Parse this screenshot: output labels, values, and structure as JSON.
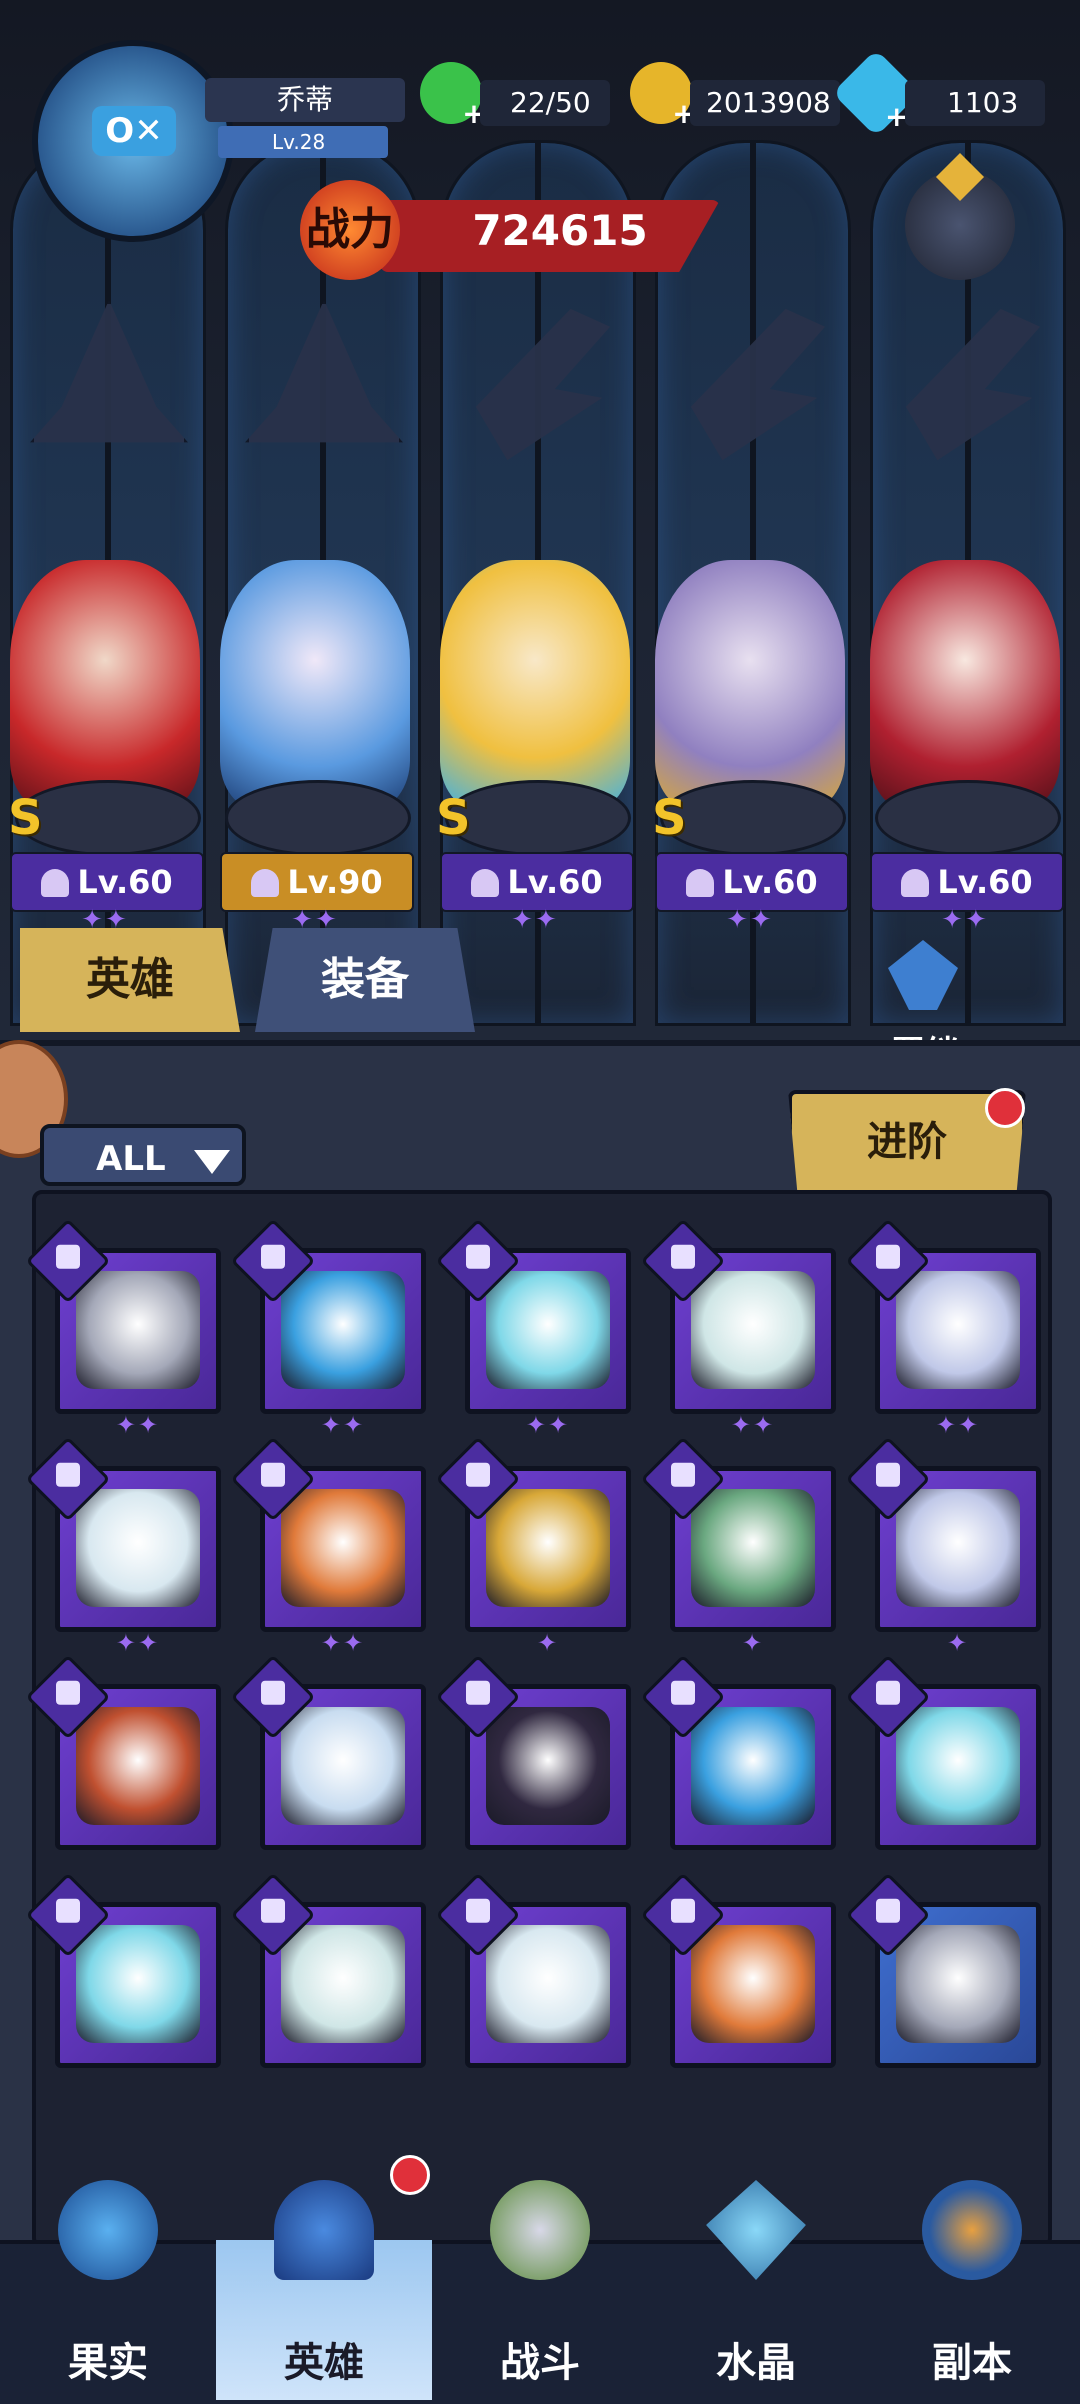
{
  "player": {
    "name": "乔蒂",
    "level": "Lv.28"
  },
  "resources": {
    "stamina": "22/50",
    "gold": "2013908",
    "diamonds": "1103"
  },
  "power": {
    "label": "战力",
    "value": "724615"
  },
  "heroes": [
    {
      "level": "Lv.60",
      "s_rank": "S",
      "stars": "✦✦",
      "class_icon": "mage-hat-icon"
    },
    {
      "level": "Lv.90",
      "s_rank": "",
      "stars": "✦✦",
      "class_icon": "mage-hat-icon"
    },
    {
      "level": "Lv.60",
      "s_rank": "S",
      "stars": "✦✦",
      "class_icon": "wing-icon"
    },
    {
      "level": "Lv.60",
      "s_rank": "S",
      "stars": "✦✦",
      "class_icon": "wing-icon"
    },
    {
      "level": "Lv.60",
      "s_rank": "",
      "stars": "✦✦",
      "class_icon": "wing-icon"
    }
  ],
  "tabs": {
    "heroes": "英雄",
    "equipment": "装备"
  },
  "bond": {
    "label": "羁绊"
  },
  "filter": {
    "label": "ALL"
  },
  "advance": {
    "label": "进阶"
  },
  "cards": [
    {
      "name": "knight-helmet",
      "stars": "✦✦",
      "color": "#a4a8b8"
    },
    {
      "name": "fishbowl-robot",
      "stars": "✦✦",
      "color": "#3aa0e0"
    },
    {
      "name": "armored-mech",
      "stars": "✦✦",
      "color": "#7fd8e8"
    },
    {
      "name": "ghost-crystal",
      "stars": "✦✦",
      "color": "#cfe6e6"
    },
    {
      "name": "dragon-beast",
      "stars": "✦✦",
      "color": "#c0c8e8"
    },
    {
      "name": "polar-bear",
      "stars": "✦✦",
      "color": "#d8e8f0"
    },
    {
      "name": "fox-warrior",
      "stars": "✦✦",
      "color": "#e07a3a"
    },
    {
      "name": "gold-mech",
      "stars": "✦",
      "color": "#d8a838"
    },
    {
      "name": "elf-queen",
      "stars": "✦",
      "color": "#6aa880"
    },
    {
      "name": "dragon-beast-2",
      "stars": "✦",
      "color": "#c0c8e8"
    },
    {
      "name": "red-hood",
      "stars": "",
      "color": "#c05030"
    },
    {
      "name": "ice-princess",
      "stars": "",
      "color": "#c8dcf0"
    },
    {
      "name": "dark-maiden",
      "stars": "",
      "color": "#302840"
    },
    {
      "name": "fishbowl-robot-2",
      "stars": "",
      "color": "#3aa0e0"
    },
    {
      "name": "armored-mech-2",
      "stars": "",
      "color": "#7fd8e8"
    },
    {
      "name": "armored-mech-3",
      "stars": "",
      "color": "#7fd8e8"
    },
    {
      "name": "ghost-crystal-2",
      "stars": "",
      "color": "#cfe6e6"
    },
    {
      "name": "polar-bear-2",
      "stars": "",
      "color": "#d8e8f0"
    },
    {
      "name": "fox-warrior-2",
      "stars": "",
      "color": "#e07a3a"
    },
    {
      "name": "knight-helmet-2",
      "stars": "",
      "color": "#a4a8b8"
    }
  ],
  "nav": [
    {
      "label": "果实",
      "active": false
    },
    {
      "label": "英雄",
      "active": true
    },
    {
      "label": "战斗",
      "active": false
    },
    {
      "label": "水晶",
      "active": false
    },
    {
      "label": "副本",
      "active": false
    }
  ]
}
